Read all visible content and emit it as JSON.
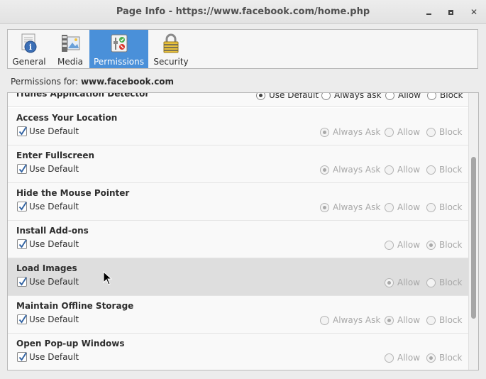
{
  "window": {
    "title": "Page Info - https://www.facebook.com/home.php",
    "minimize_label": "",
    "maximize_label": "",
    "close_label": "✕"
  },
  "tabs": [
    {
      "label": "General",
      "icon": "info-icon"
    },
    {
      "label": "Media",
      "icon": "media-icon"
    },
    {
      "label": "Permissions",
      "icon": "permissions-icon",
      "selected": true
    },
    {
      "label": "Security",
      "icon": "lock-icon"
    }
  ],
  "permissions_header": {
    "prefix": "Permissions for:",
    "site": "www.facebook.com"
  },
  "partial_row": {
    "name": "iTunes Application Detector",
    "options": [
      "Use Default",
      "Always ask",
      "Allow",
      "Block"
    ],
    "selected": "Use Default"
  },
  "rows": [
    {
      "name": "Access Your Location",
      "use_default": "Use Default",
      "options": [
        "Always Ask",
        "Allow",
        "Block"
      ],
      "selected": "Always Ask"
    },
    {
      "name": "Enter Fullscreen",
      "use_default": "Use Default",
      "options": [
        "Always Ask",
        "Allow",
        "Block"
      ],
      "selected": "Always Ask"
    },
    {
      "name": "Hide the Mouse Pointer",
      "use_default": "Use Default",
      "options": [
        "Always Ask",
        "Allow",
        "Block"
      ],
      "selected": "Always Ask"
    },
    {
      "name": "Install Add-ons",
      "use_default": "Use Default",
      "options": [
        "Allow",
        "Block"
      ],
      "selected": "Block"
    },
    {
      "name": "Load Images",
      "use_default": "Use Default",
      "options": [
        "Allow",
        "Block"
      ],
      "selected": "Allow"
    },
    {
      "name": "Maintain Offline Storage",
      "use_default": "Use Default",
      "options": [
        "Always Ask",
        "Allow",
        "Block"
      ],
      "selected": "Allow"
    },
    {
      "name": "Open Pop-up Windows",
      "use_default": "Use Default",
      "options": [
        "Allow",
        "Block"
      ],
      "selected": "Block"
    }
  ],
  "colors": {
    "accent": "#4a90d9",
    "disabled_text": "#a8a8a8",
    "highlight_row": "#dedede"
  }
}
